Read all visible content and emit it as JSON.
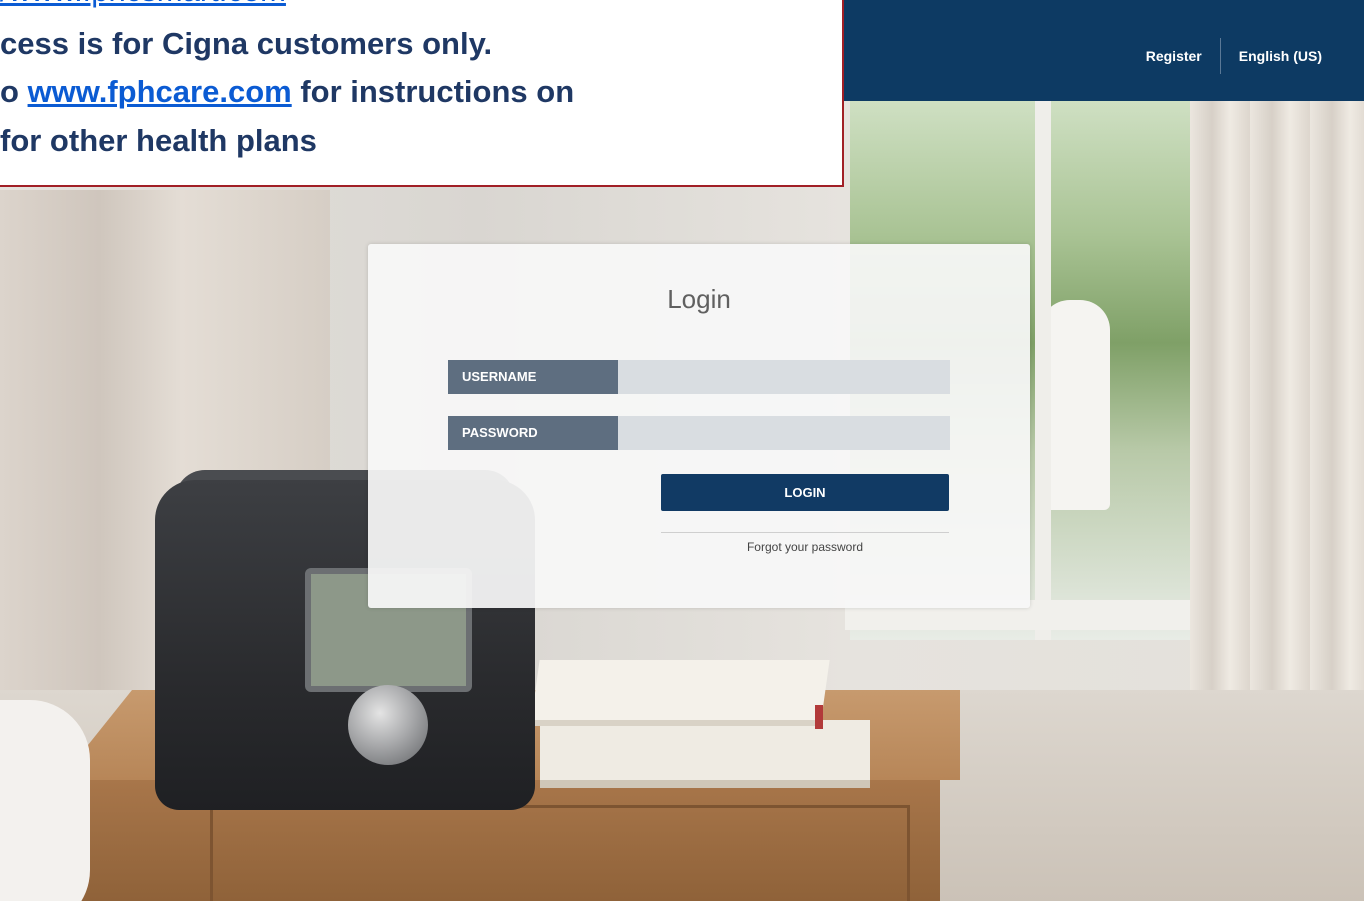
{
  "header": {
    "register_label": "Register",
    "language_label": "English (US)"
  },
  "notice": {
    "line0_link": "/www.fphcsmart.com",
    "line1": "cess is for Cigna customers only.",
    "line2_prefix": "o ",
    "line2_link": "www.fphcare.com",
    "line2_suffix": " for instructions on",
    "line3": " for other health plans"
  },
  "login": {
    "title": "Login",
    "username_label": "USERNAME",
    "password_label": "PASSWORD",
    "login_button": "LOGIN",
    "forgot_link": "Forgot your password"
  },
  "colors": {
    "navbar": "#0d3a63",
    "notice_text": "#1f3864",
    "notice_link": "#0b5bd3",
    "notice_border": "#a11f26",
    "field_label_bg": "#5e6e80",
    "login_button_bg": "#113a64"
  }
}
